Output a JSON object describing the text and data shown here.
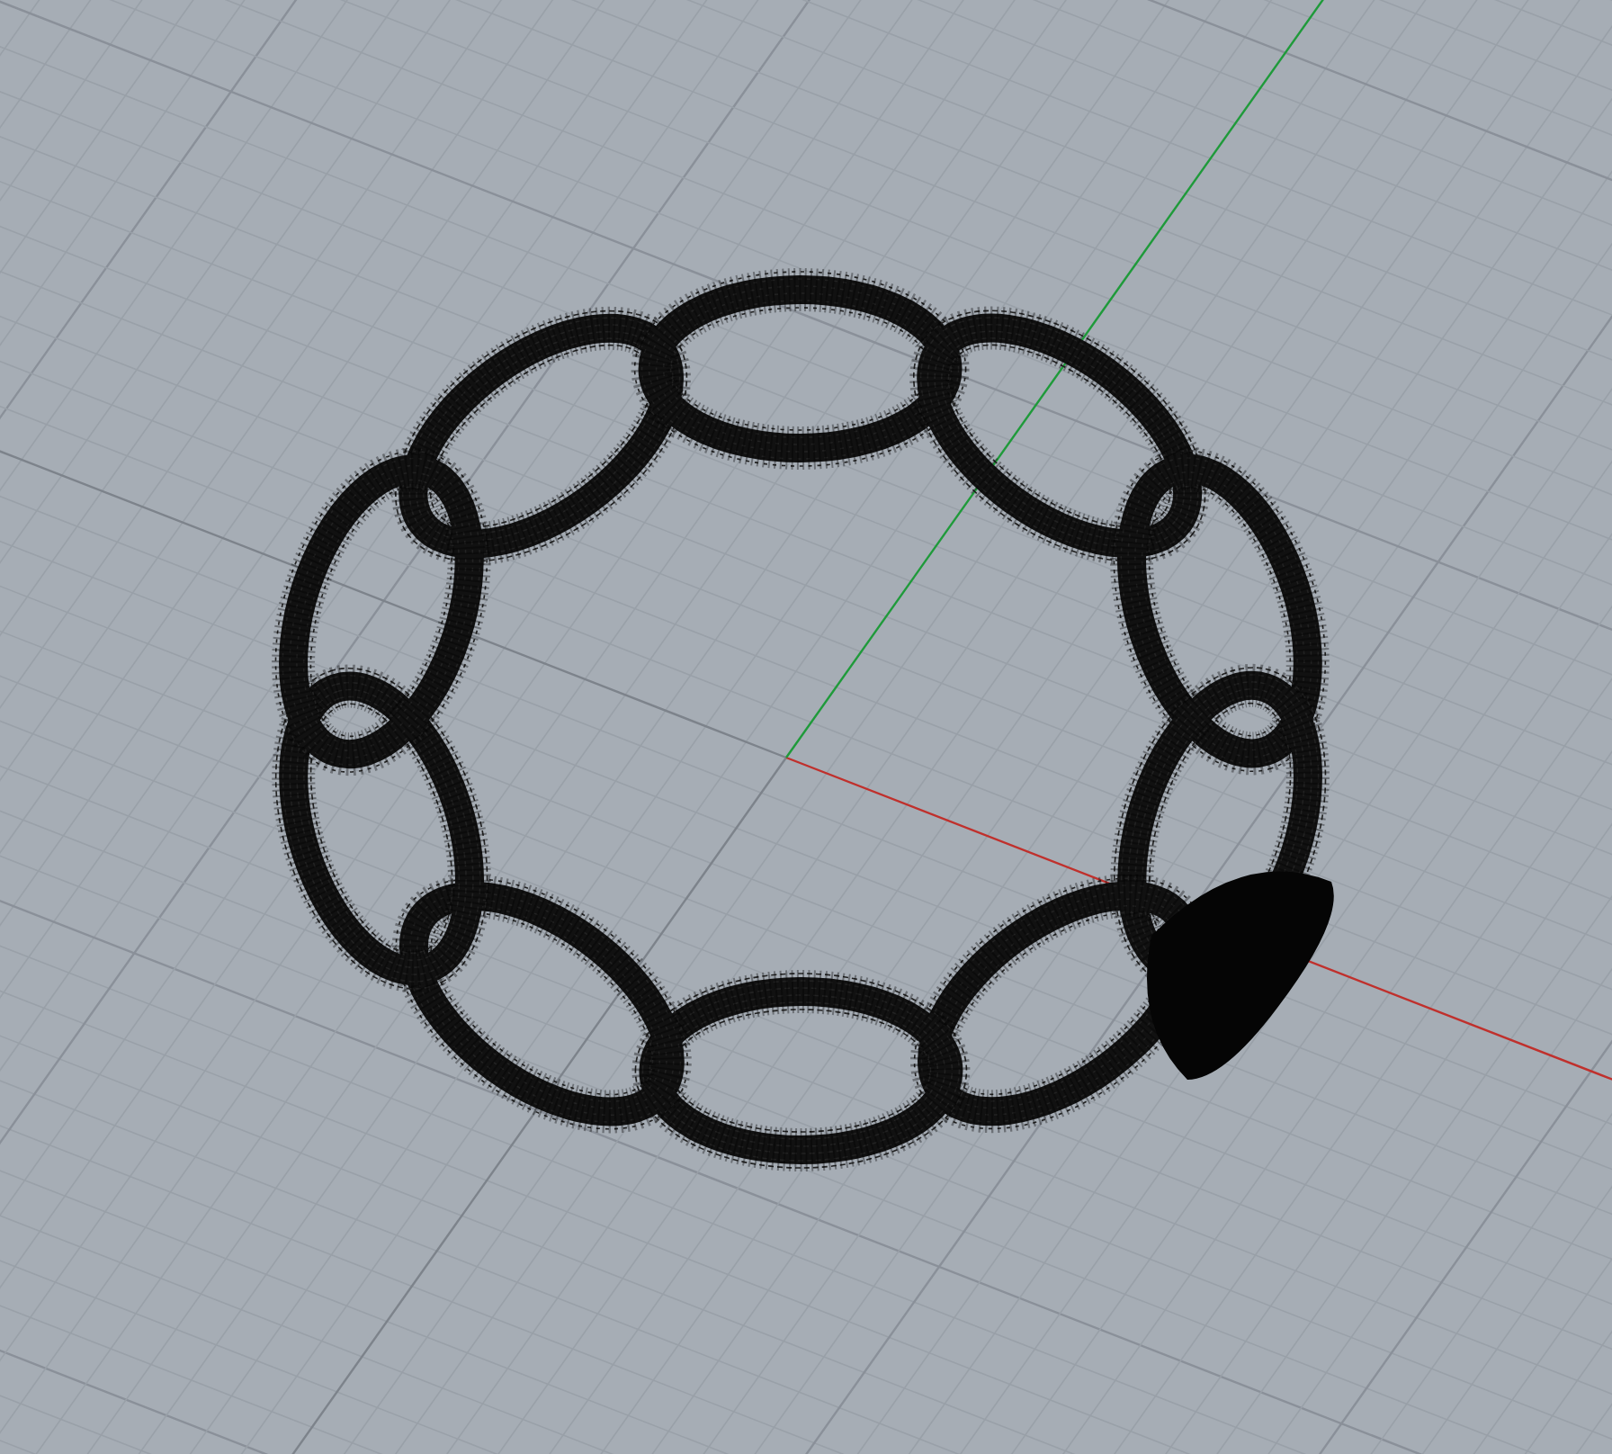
{
  "viewport": {
    "kind": "perspective",
    "grid": true,
    "axes": true
  }
}
